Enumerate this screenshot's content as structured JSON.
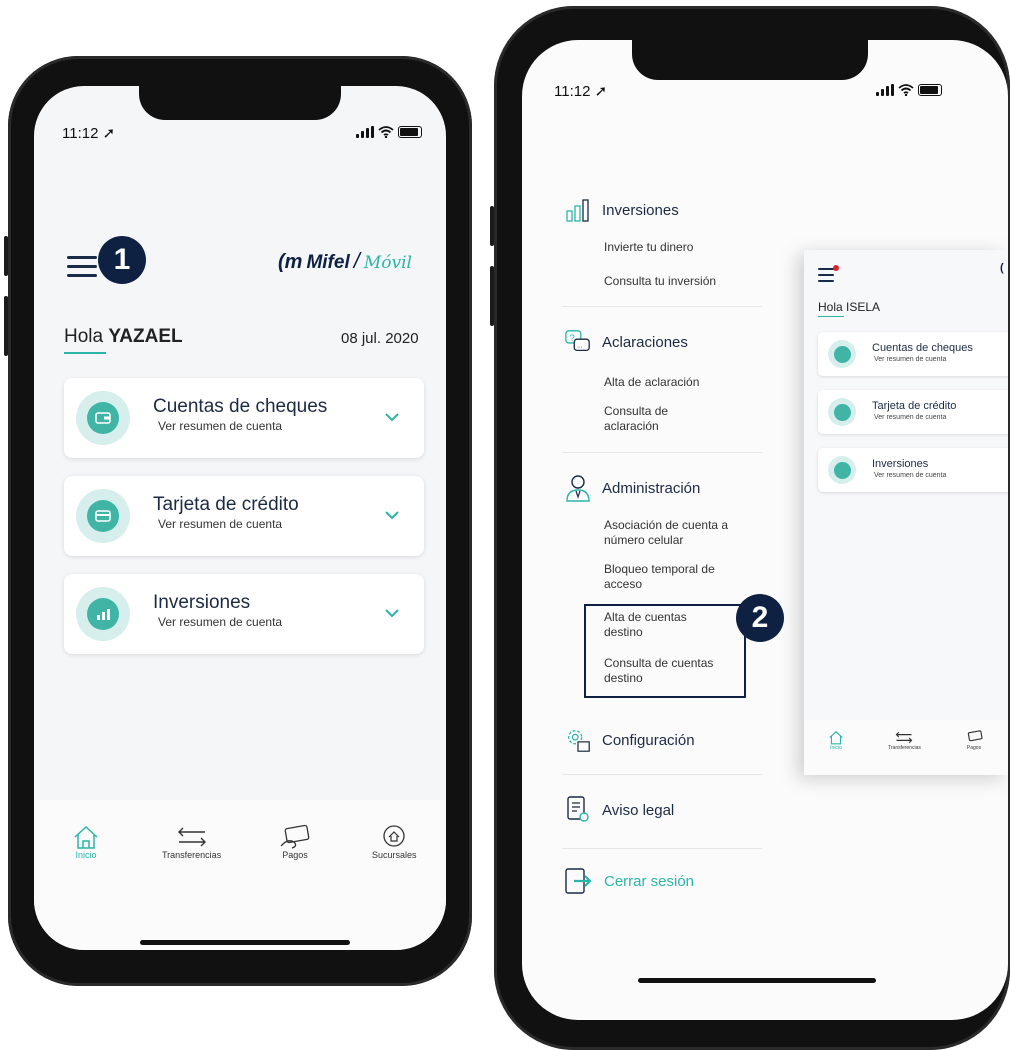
{
  "left": {
    "status": {
      "time": "11:12 ➚"
    },
    "badge": "1",
    "logo": {
      "mifel": "Mifel",
      "movil": "Móvil"
    },
    "greeting": {
      "hello": "Hola",
      "name": "YAZAEL"
    },
    "date": "08 jul. 2020",
    "cards": [
      {
        "title": "Cuentas de cheques",
        "subtitle": "Ver resumen de cuenta"
      },
      {
        "title": "Tarjeta de crédito",
        "subtitle": "Ver resumen de cuenta"
      },
      {
        "title": "Inversiones",
        "subtitle": "Ver resumen de cuenta"
      }
    ],
    "nav": [
      "Inicio",
      "Transferencias",
      "Pagos",
      "Sucursales"
    ]
  },
  "right": {
    "status": {
      "time": "11:12 ➚"
    },
    "badge": "2",
    "menu": {
      "inversiones": {
        "title": "Inversiones",
        "items": [
          "Invierte tu dinero",
          "Consulta tu inversión"
        ]
      },
      "aclaraciones": {
        "title": "Aclaraciones",
        "items": [
          "Alta de aclaración",
          "Consulta de aclaración"
        ]
      },
      "administracion": {
        "title": "Administración",
        "items": [
          "Asociación de cuenta a número celular",
          "Bloqueo temporal de acceso",
          "Alta de cuentas destino",
          "Consulta de cuentas destino"
        ]
      },
      "configuracion": {
        "title": "Configuración"
      },
      "aviso": {
        "title": "Aviso legal"
      },
      "logout": {
        "title": "Cerrar sesión"
      }
    },
    "overlay": {
      "greeting": {
        "hello": "Hola",
        "name": "ISELA"
      },
      "cards": [
        {
          "title": "Cuentas de cheques",
          "subtitle": "Ver resumen de cuenta"
        },
        {
          "title": "Tarjeta de crédito",
          "subtitle": "Ver resumen de cuenta"
        },
        {
          "title": "Inversiones",
          "subtitle": "Ver resumen de cuenta"
        }
      ],
      "nav": [
        "Inicio",
        "Transferencias",
        "Pagos"
      ]
    }
  },
  "colors": {
    "accent": "#2bb5a8",
    "navy": "#0f2142",
    "notification": "#e0202a"
  }
}
